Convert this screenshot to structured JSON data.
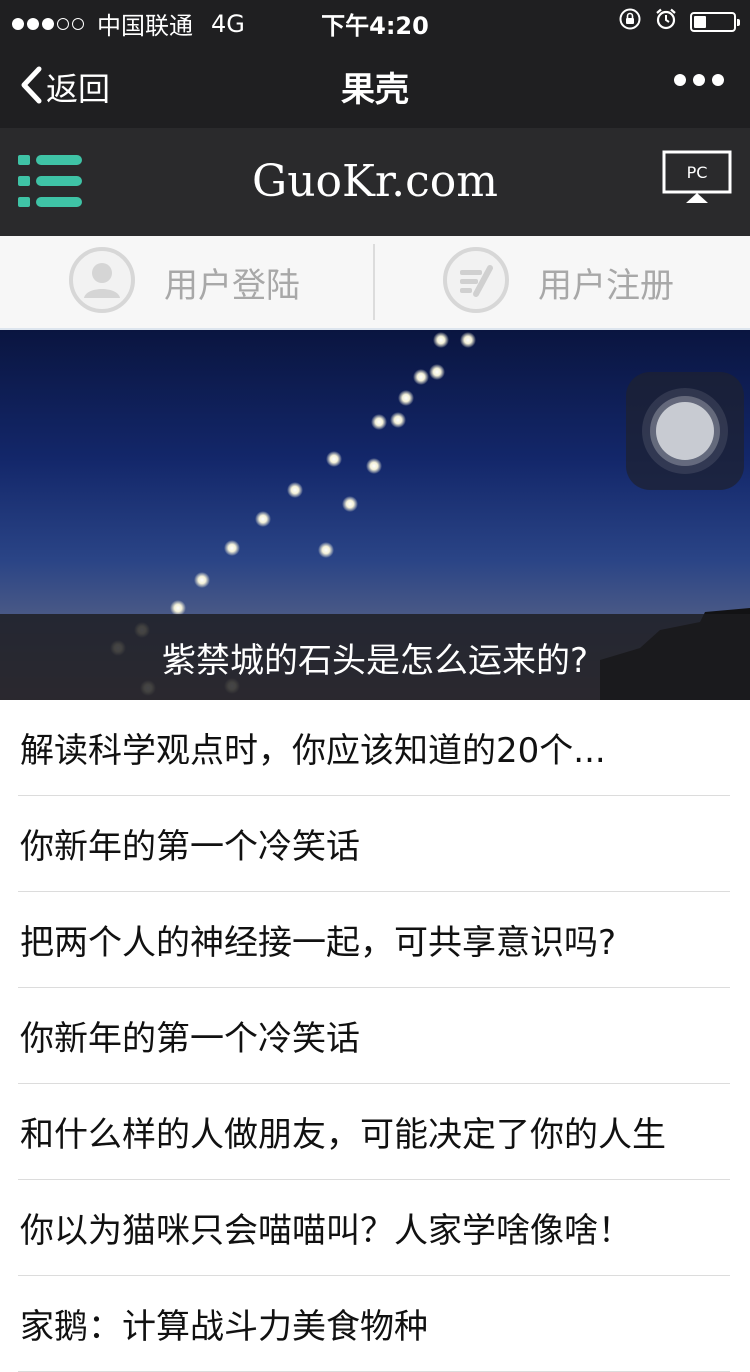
{
  "status_bar": {
    "carrier": "中国联通",
    "network": "4G",
    "time": "下午4:20",
    "signal_bars_filled": 3,
    "signal_bars_total": 5,
    "battery_level": 0.32,
    "icons": [
      "orientation-lock-icon",
      "alarm-icon",
      "battery-icon"
    ]
  },
  "nav": {
    "back_label": "返回",
    "title": "果壳",
    "back_icon": "chevron-left-icon",
    "more_icon": "more-dots-icon"
  },
  "site": {
    "logo": "GuoKr.com",
    "menu_icon": "menu-list-icon",
    "pc_label": "PC",
    "accent_color": "#3fc3a6"
  },
  "user_bar": {
    "login_label": "用户登陆",
    "register_label": "用户注册",
    "login_icon": "user-avatar-icon",
    "register_icon": "register-form-icon"
  },
  "banner": {
    "caption": "紫禁城的石头是怎么运来的?"
  },
  "articles": [
    "解读科学观点时，你应该知道的20个...",
    "你新年的第一个冷笑话",
    "把两个人的神经接一起，可共享意识吗?",
    "你新年的第一个冷笑话",
    "和什么样的人做朋友，可能决定了你的人生",
    "你以为猫咪只会喵喵叫？人家学啥像啥！",
    "家鹅：计算战斗力美食物种"
  ]
}
